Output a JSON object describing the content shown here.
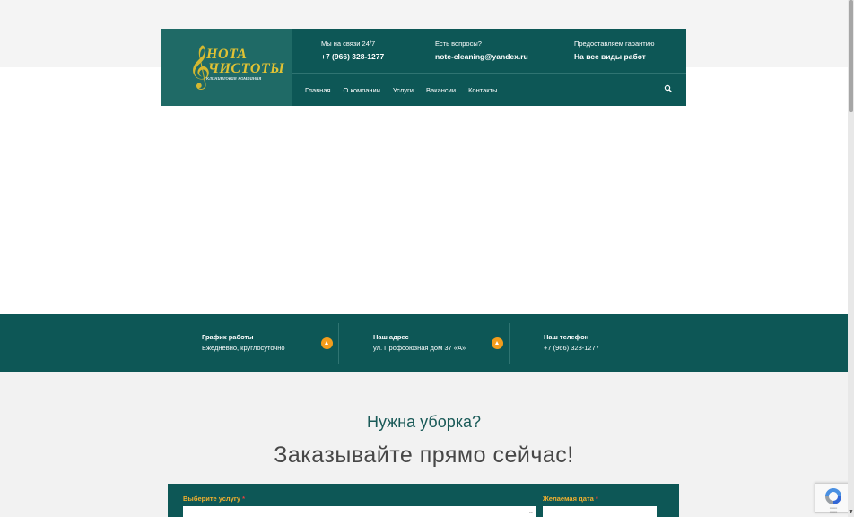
{
  "header": {
    "logo": {
      "line1": "НОТА",
      "line2": "ЧИСТОТЫ",
      "tagline": "клининговая компания"
    },
    "info": [
      {
        "label": "Мы на связи 24/7",
        "value": "+7 (966) 328-1277"
      },
      {
        "label": "Есть вопросы?",
        "value": "note-cleaning@yandex.ru"
      },
      {
        "label": "Предоставляем гарантию",
        "value": "На все виды работ"
      }
    ],
    "nav": [
      "Главная",
      "О компании",
      "Услуги",
      "Вакансии",
      "Контакты"
    ]
  },
  "contact_strip": [
    {
      "title": "График работы",
      "text": "Ежедневно, круглосуточно"
    },
    {
      "title": "Наш адрес",
      "text": "ул. Профсоюзная дом 37 «А»"
    },
    {
      "title": "Наш телефон",
      "text": "+7 (966) 328-1277"
    }
  ],
  "promo": {
    "subtitle": "Нужна уборка?",
    "title": "Заказывайте прямо сейчас!"
  },
  "form": {
    "service_label": "Выберите услугу",
    "date_label": "Желаемая дата",
    "required_mark": "*"
  },
  "colors": {
    "primary": "#0d5756",
    "logo_bg": "#1f6a66",
    "accent_orange": "#f29d1c",
    "label_gold": "#f2b02f"
  }
}
